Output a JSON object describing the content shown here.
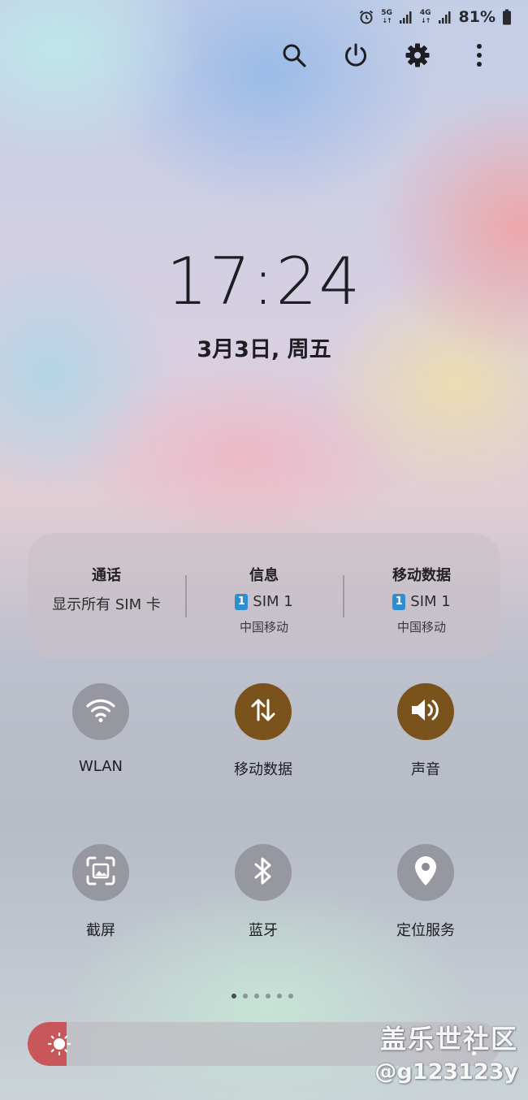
{
  "status_bar": {
    "network_1": "5G",
    "network_2": "4G",
    "battery_percent": "81%",
    "icons": [
      "alarm-icon",
      "signal-icon",
      "battery-icon"
    ]
  },
  "action_bar": {
    "icons": [
      "search-icon",
      "power-icon",
      "gear-icon",
      "more-vertical-icon"
    ]
  },
  "clock": {
    "time": "17:24",
    "date": "3月3日, 周五"
  },
  "sim_panel": {
    "call": {
      "title": "通话",
      "value": "显示所有 SIM 卡"
    },
    "messages": {
      "title": "信息",
      "sim": "SIM 1",
      "sim_number": "1",
      "carrier": "中国移动"
    },
    "mobile_data": {
      "title": "移动数据",
      "sim": "SIM 1",
      "sim_number": "1",
      "carrier": "中国移动"
    }
  },
  "toggles": [
    {
      "label": "WLAN",
      "icon": "wifi-icon",
      "active": false
    },
    {
      "label": "移动数据",
      "icon": "data-transfer-icon",
      "active": true
    },
    {
      "label": "声音",
      "icon": "speaker-icon",
      "active": true
    },
    {
      "label": "截屏",
      "icon": "screenshot-icon",
      "active": false
    },
    {
      "label": "蓝牙",
      "icon": "bluetooth-icon",
      "active": false
    },
    {
      "label": "定位服务",
      "icon": "location-pin-icon",
      "active": false
    }
  ],
  "pagination": {
    "total_pages": 6,
    "current_page": 1
  },
  "brightness": {
    "level": 0.08,
    "icon": "sun-icon"
  },
  "watermark": {
    "line1": "盖乐世社区",
    "line2": "@g123123y"
  },
  "colors": {
    "toggle_active": "#7a531c",
    "toggle_inactive": "#8c8c94",
    "brightness_fill": "#c8565b",
    "sim_badge": "#2e8ed0"
  }
}
